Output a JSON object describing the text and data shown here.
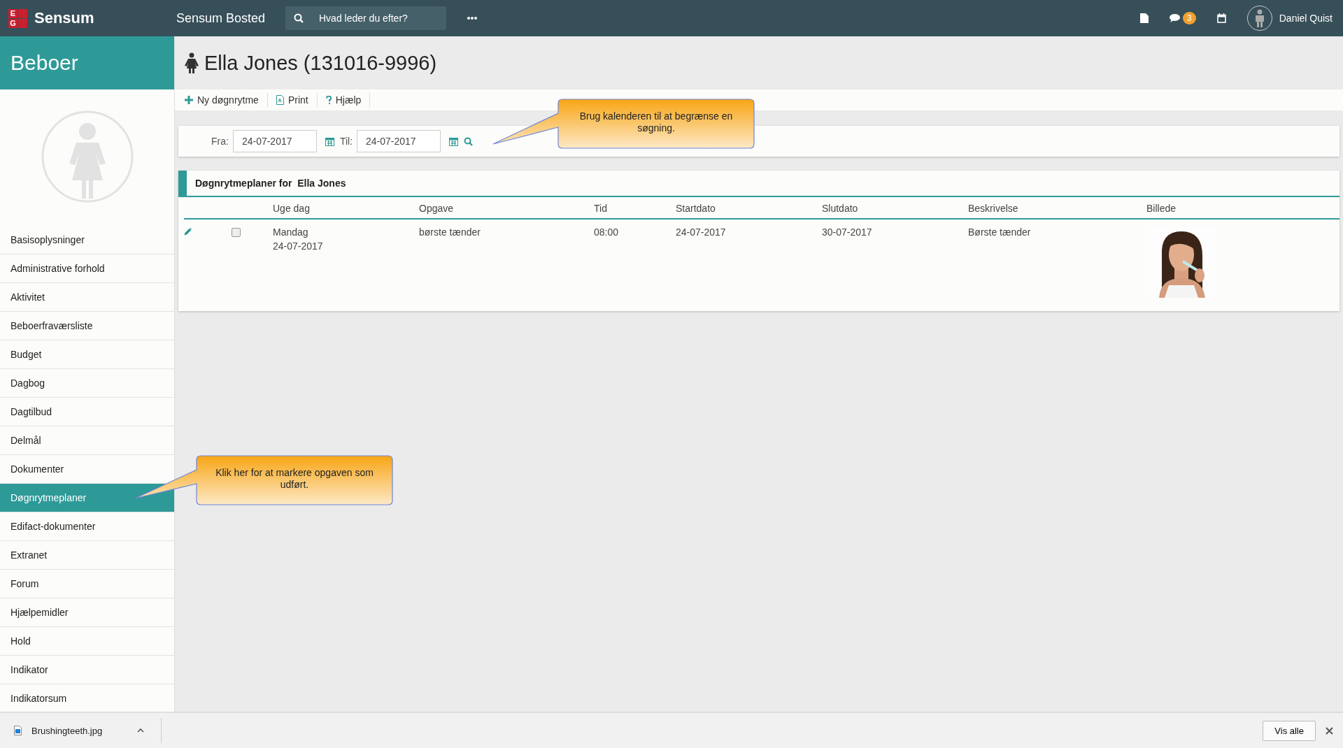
{
  "topbar": {
    "logo_letters": [
      "E",
      "G"
    ],
    "brand": "Sensum",
    "app_title": "Sensum Bosted",
    "search": {
      "placeholder": "Hvad leder du efter?"
    },
    "messages_badge": "3",
    "user_name": "Daniel Quist"
  },
  "sidebar": {
    "title": "Beboer",
    "items": [
      {
        "label": "Basisoplysninger",
        "selected": false
      },
      {
        "label": "Administrative forhold",
        "selected": false
      },
      {
        "label": "Aktivitet",
        "selected": false
      },
      {
        "label": "Beboerfraværsliste",
        "selected": false
      },
      {
        "label": "Budget",
        "selected": false
      },
      {
        "label": "Dagbog",
        "selected": false
      },
      {
        "label": "Dagtilbud",
        "selected": false
      },
      {
        "label": "Delmål",
        "selected": false
      },
      {
        "label": "Dokumenter",
        "selected": false
      },
      {
        "label": "Døgnrytmeplaner",
        "selected": true
      },
      {
        "label": "Edifact-dokumenter",
        "selected": false
      },
      {
        "label": "Extranet",
        "selected": false
      },
      {
        "label": "Forum",
        "selected": false
      },
      {
        "label": "Hjælpemidler",
        "selected": false
      },
      {
        "label": "Hold",
        "selected": false
      },
      {
        "label": "Indikator",
        "selected": false
      },
      {
        "label": "Indikatorsum",
        "selected": false
      }
    ]
  },
  "page_title": "Ella Jones (131016-9996)",
  "toolbar": [
    {
      "kind": "add",
      "label": "Ny døgnrytme"
    },
    {
      "kind": "pdf",
      "label": "Print"
    },
    {
      "kind": "help",
      "label": "Hjælp"
    }
  ],
  "filter": {
    "from_label": "Fra:",
    "from_value": "24-07-2017",
    "to_label": "Til:",
    "to_value": "24-07-2017"
  },
  "table": {
    "title": "Døgnrytmeplaner for  Ella Jones",
    "columns": [
      "Uge dag",
      "Opgave",
      "Tid",
      "Startdato",
      "Slutdato",
      "Beskrivelse",
      "Billede"
    ],
    "rows": [
      {
        "checked": false,
        "weekday": "Mandag",
        "date": "24-07-2017",
        "task": "børste tænder",
        "time": "08:00",
        "start": "24-07-2017",
        "end": "30-07-2017",
        "description": "Børste tænder"
      }
    ]
  },
  "callouts": [
    {
      "kind": "filter",
      "text": "Brug kalenderen til at begrænse en søgning."
    },
    {
      "kind": "sidebar",
      "text": "Klik her for at markere opgaven som udført."
    }
  ],
  "downloads": {
    "file": "Brushingteeth.jpg",
    "show_all": "Vis alle"
  }
}
